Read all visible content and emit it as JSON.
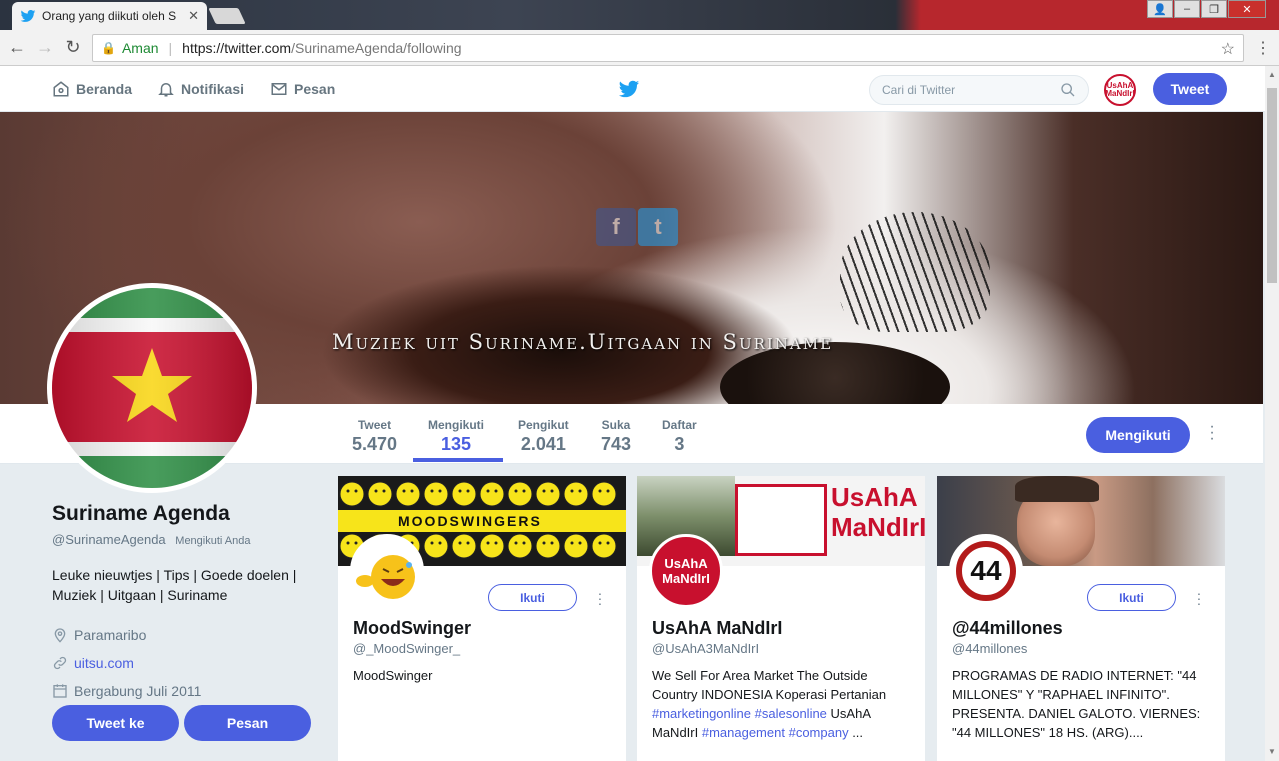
{
  "browser": {
    "tab_title": "Orang yang diikuti oleh S",
    "secure_label": "Aman",
    "url_host": "https://twitter.com",
    "url_path": "/SurinameAgenda/following"
  },
  "header": {
    "nav": [
      {
        "label": "Beranda",
        "icon": "home-icon"
      },
      {
        "label": "Notifikasi",
        "icon": "bell-icon"
      },
      {
        "label": "Pesan",
        "icon": "envelope-icon"
      }
    ],
    "search_placeholder": "Cari di Twitter",
    "avatar_text": "UsAhA MaNdIrI",
    "tweet_button": "Tweet"
  },
  "banner": {
    "text": "Muziek uit Suriname.Uitgaan in Suriname",
    "social_f": "f",
    "social_t": "t"
  },
  "stats": [
    {
      "label": "Tweet",
      "value": "5.470"
    },
    {
      "label": "Mengikuti",
      "value": "135"
    },
    {
      "label": "Pengikut",
      "value": "2.041"
    },
    {
      "label": "Suka",
      "value": "743"
    },
    {
      "label": "Daftar",
      "value": "3"
    }
  ],
  "following_button": "Mengikuti",
  "profile": {
    "name": "Suriname Agenda",
    "handle": "@SurinameAgenda",
    "follows_you": "Mengikuti Anda",
    "bio": "Leuke nieuwtjes | Tips | Goede doelen | Muziek | Uitgaan | Suriname",
    "location": "Paramaribo",
    "website": "uitsu.com",
    "joined": "Bergabung Juli 2011",
    "tweet_to": "Tweet ke",
    "message": "Pesan"
  },
  "cards": [
    {
      "name": "MoodSwinger",
      "handle": "@_MoodSwinger_",
      "bio": "MoodSwinger",
      "banner_text": "MOODSWINGERS",
      "follow_label": "Ikuti"
    },
    {
      "name": "UsAhA MaNdIrI",
      "handle": "@UsAhA3MaNdIrI",
      "bio_parts": [
        "We Sell For Area Market The Outside Country INDONESIA Koperasi Pertanian ",
        "#marketingonline",
        " ",
        "#salesonline",
        " UsAhA MaNdIrI ",
        "#management",
        " ",
        "#company",
        " ..."
      ],
      "banner_text_1": "UsAhA",
      "banner_text_2": "MaNdIrI",
      "avatar_text": "UsAhA MaNdIrI"
    },
    {
      "name": "@44millones",
      "handle": "@44millones",
      "bio": "PROGRAMAS DE RADIO INTERNET: \"44 MILLONES\" Y \"RAPHAEL INFINITO\". PRESENTA. DANIEL GALOTO. VIERNES: \"44 MILLONES\" 18 HS. (ARG)....",
      "avatar_text": "44",
      "follow_label": "Ikuti"
    }
  ],
  "colors": {
    "brand": "#4a5fe0",
    "twitter_blue": "#1da1f2",
    "text_muted": "#657786"
  }
}
